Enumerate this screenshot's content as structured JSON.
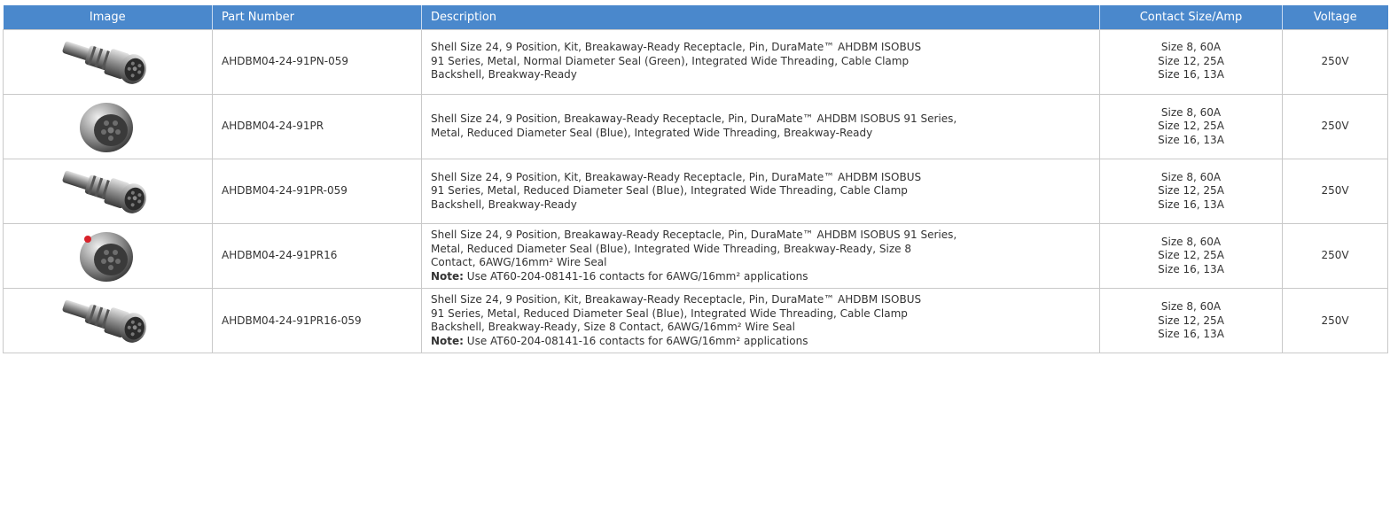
{
  "columns": {
    "image": "Image",
    "part_number": "Part Number",
    "description": "Description",
    "contact_size_amp": "Contact Size/Amp",
    "voltage": "Voltage"
  },
  "rows": [
    {
      "part_number": "AHDBM04-24-91PN-059",
      "image_icon": "connector-receptacle-with-backshell-icon",
      "description_lines": [
        "Shell Size 24, 9 Position, Kit, Breakaway-Ready Receptacle, Pin, DuraMate™ AHDBM ISOBUS",
        "91 Series, Metal, Normal Diameter Seal (Green), Integrated Wide Threading, Cable Clamp",
        "Backshell, Breakway-Ready"
      ],
      "note_label": "",
      "note_text": "",
      "contact_sizes": [
        "Size 8, 60A",
        "Size 12, 25A",
        "Size 16, 13A"
      ],
      "voltage": "250V"
    },
    {
      "part_number": "AHDBM04-24-91PR",
      "image_icon": "connector-receptacle-icon",
      "description_lines": [
        "Shell Size 24, 9 Position, Breakaway-Ready Receptacle, Pin, DuraMate™ AHDBM ISOBUS 91 Series,",
        "Metal, Reduced Diameter Seal (Blue), Integrated Wide Threading, Breakway-Ready",
        ""
      ],
      "note_label": "",
      "note_text": "",
      "contact_sizes": [
        "Size 8, 60A",
        "Size 12, 25A",
        "Size 16, 13A"
      ],
      "voltage": "250V"
    },
    {
      "part_number": "AHDBM04-24-91PR-059",
      "image_icon": "connector-receptacle-with-backshell-icon",
      "description_lines": [
        "Shell Size 24, 9 Position, Kit, Breakaway-Ready Receptacle, Pin, DuraMate™ AHDBM ISOBUS",
        "91 Series, Metal, Reduced Diameter Seal (Blue), Integrated Wide Threading, Cable Clamp",
        "Backshell, Breakway-Ready"
      ],
      "note_label": "",
      "note_text": "",
      "contact_sizes": [
        "Size 8, 60A",
        "Size 12, 25A",
        "Size 16, 13A"
      ],
      "voltage": "250V"
    },
    {
      "part_number": "AHDBM04-24-91PR16",
      "image_icon": "connector-receptacle-red-marker-icon",
      "description_lines": [
        "Shell Size 24, 9 Position, Breakaway-Ready Receptacle, Pin, DuraMate™ AHDBM ISOBUS 91 Series,",
        "Metal, Reduced Diameter Seal (Blue), Integrated Wide Threading, Breakway-Ready, Size 8",
        "Contact, 6AWG/16mm² Wire Seal"
      ],
      "note_label": "Note:",
      "note_text": " Use AT60-204-08141-16 contacts for 6AWG/16mm² applications",
      "contact_sizes": [
        "Size 8, 60A",
        "Size 12, 25A",
        "Size 16, 13A"
      ],
      "voltage": "250V"
    },
    {
      "part_number": "AHDBM04-24-91PR16-059",
      "image_icon": "connector-receptacle-with-backshell-icon",
      "description_lines": [
        "Shell Size 24, 9 Position, Kit, Breakaway-Ready Receptacle, Pin, DuraMate™ AHDBM ISOBUS",
        "91 Series, Metal, Reduced Diameter Seal (Blue), Integrated Wide Threading, Cable Clamp",
        "Backshell, Breakway-Ready, Size 8 Contact, 6AWG/16mm² Wire Seal"
      ],
      "note_label": "Note:",
      "note_text": " Use AT60-204-08141-16 contacts for 6AWG/16mm² applications",
      "contact_sizes": [
        "Size 8, 60A",
        "Size 12, 25A",
        "Size 16, 13A"
      ],
      "voltage": "250V"
    }
  ],
  "colors": {
    "header_bg": "#4a88cc",
    "header_text": "#ffffff",
    "border": "#c9c9c9",
    "body_text": "#333333"
  }
}
